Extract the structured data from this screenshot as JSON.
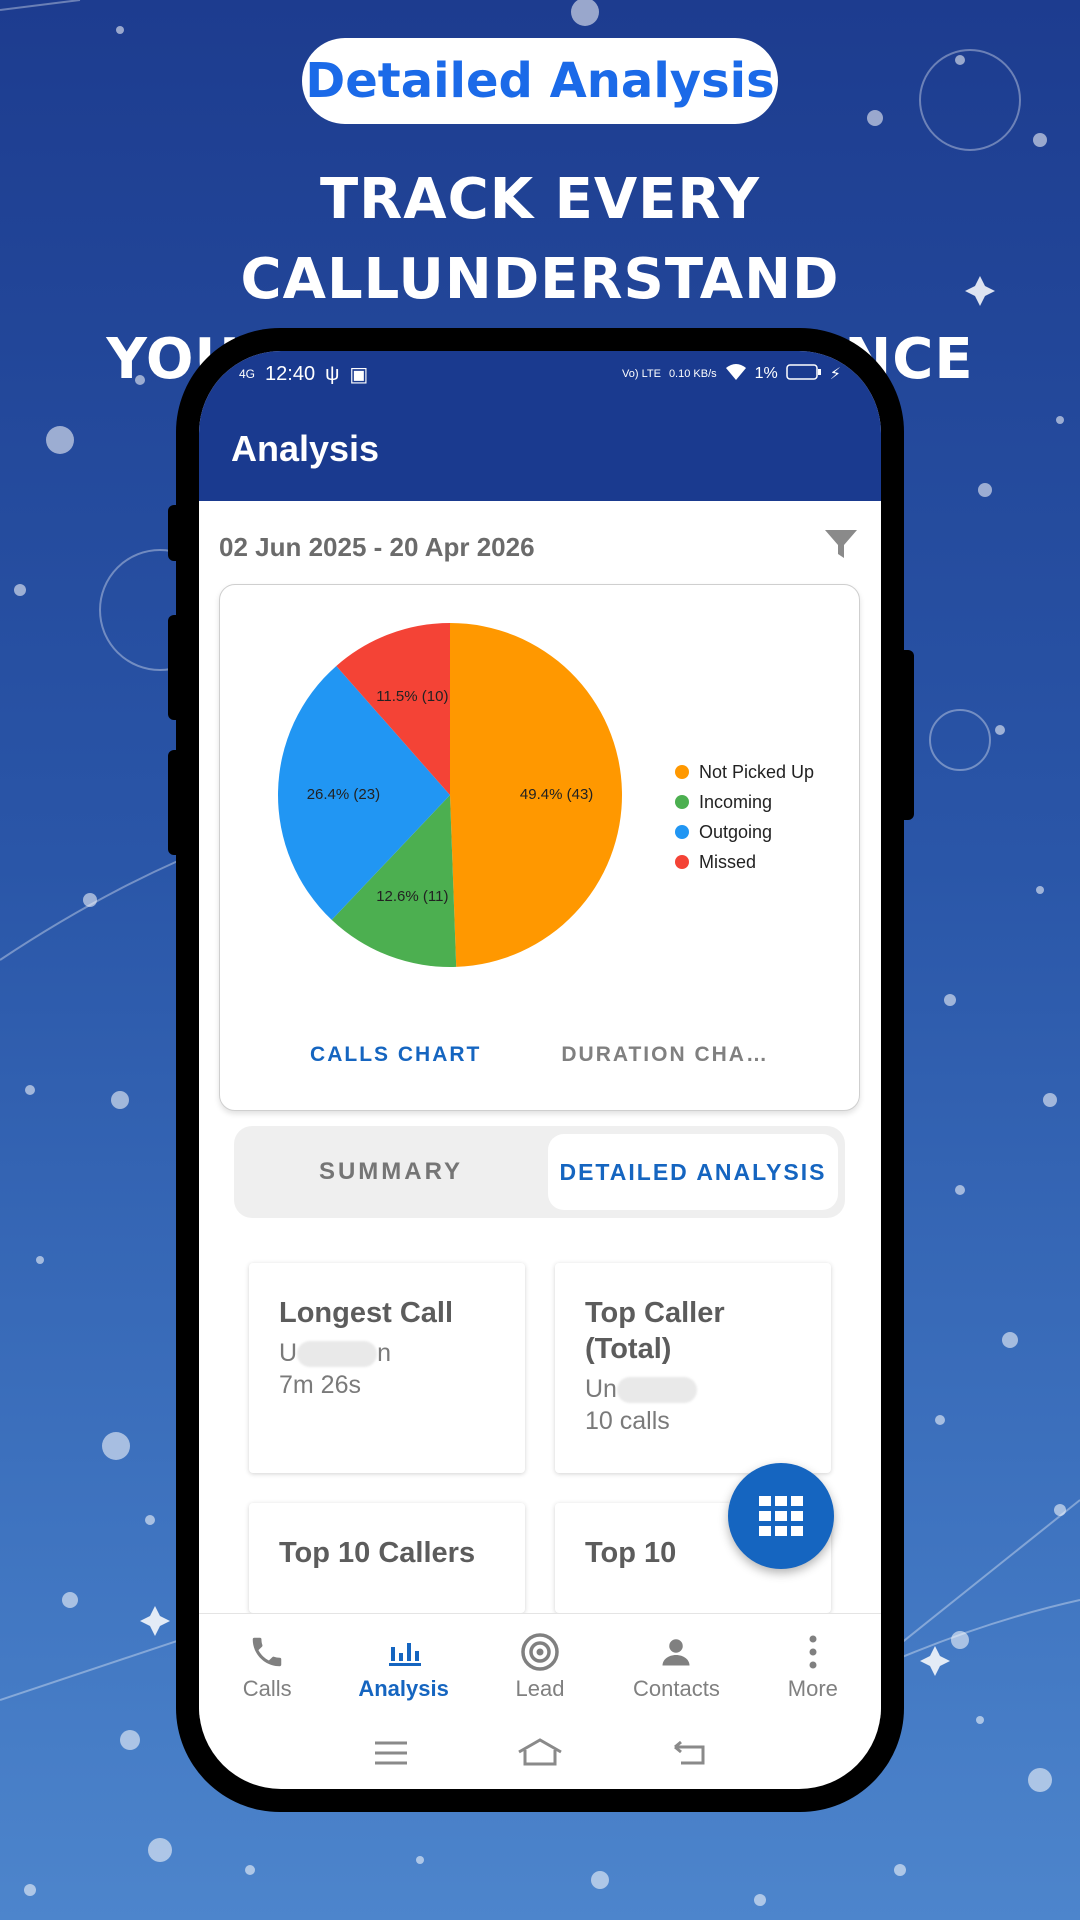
{
  "promo": {
    "pill_label": "Detailed Analysis",
    "headline_line1": "TRACK EVERY CALLUNDERSTAND",
    "headline_line2": "YOUR CALL PERFORMANCE"
  },
  "status_bar": {
    "time": "12:40",
    "network": "4G",
    "volte": "Vo) LTE",
    "speed": "0.10 KB/s",
    "battery": "1%"
  },
  "app_bar": {
    "title": "Analysis"
  },
  "filter": {
    "date_range": "02 Jun 2025 - 20 Apr 2026",
    "icon": "filter-icon"
  },
  "chart_data": {
    "type": "pie",
    "slices": [
      {
        "label": "Not Picked Up",
        "value": 43,
        "percent": 49.4,
        "display": "49.4% (43)",
        "color": "#ff9800"
      },
      {
        "label": "Incoming",
        "value": 11,
        "percent": 12.6,
        "display": "12.6% (11)",
        "color": "#4caf50"
      },
      {
        "label": "Outgoing",
        "value": 23,
        "percent": 26.4,
        "display": "26.4% (23)",
        "color": "#2196f3"
      },
      {
        "label": "Missed",
        "value": 10,
        "percent": 11.5,
        "display": "11.5% (10)",
        "color": "#f44336"
      }
    ],
    "legend_position": "right"
  },
  "chart_tabs": {
    "calls": "CALLS CHART",
    "duration": "DURATION CHA…"
  },
  "segments": {
    "summary": "SUMMARY",
    "detailed": "DETAILED ANALYSIS"
  },
  "cards": {
    "longest_call": {
      "title": "Longest Call",
      "name_start": "U",
      "name_end": "n",
      "value": "7m 26s"
    },
    "top_caller": {
      "title": "Top Caller (Total)",
      "name_start": "Un",
      "value": "10 calls"
    },
    "top_10_callers": {
      "title": "Top 10 Callers"
    },
    "top_10": {
      "title": "Top 10"
    }
  },
  "bottom_nav": {
    "calls": "Calls",
    "analysis": "Analysis",
    "lead": "Lead",
    "contacts": "Contacts",
    "more": "More"
  },
  "colors": {
    "primary": "#1a3a8f",
    "accent": "#1565c0"
  }
}
